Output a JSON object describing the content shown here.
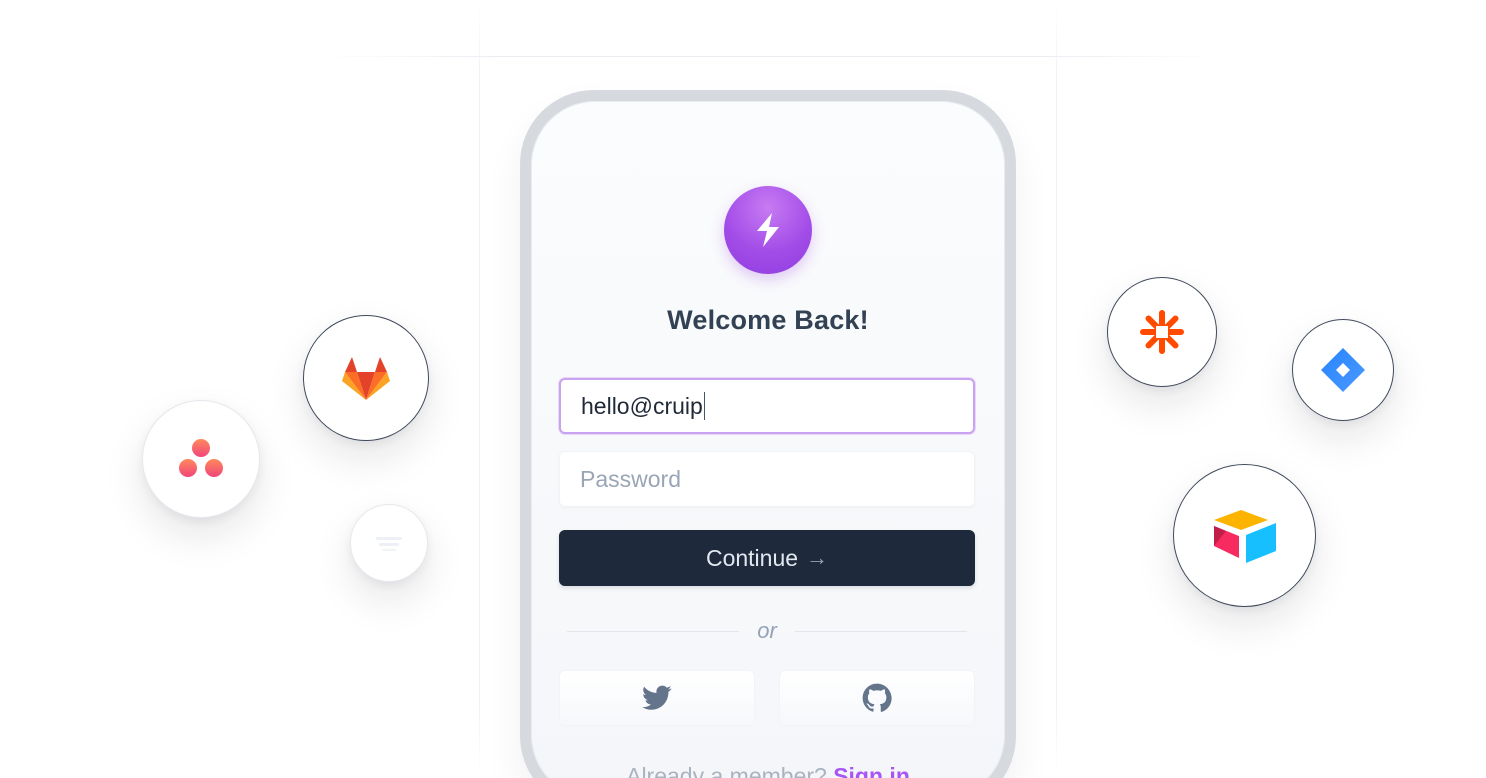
{
  "auth": {
    "title": "Welcome Back!",
    "email_value": "hello@cruip",
    "password_placeholder": "Password",
    "continue_label": "Continue",
    "continue_arrow": "→",
    "divider_text": "or",
    "footer_text": "Already a member?",
    "footer_link": "Sign in"
  },
  "icons": {
    "logo": "lightning-icon",
    "social": [
      "twitter-icon",
      "github-icon"
    ],
    "integrations": [
      "asana-icon",
      "gitlab-icon",
      "placeholder-logo-icon",
      "zapier-icon",
      "jira-icon",
      "airtable-icon"
    ]
  },
  "colors": {
    "accent": "#a855f7",
    "button": "#1e293b",
    "title": "#334155"
  }
}
